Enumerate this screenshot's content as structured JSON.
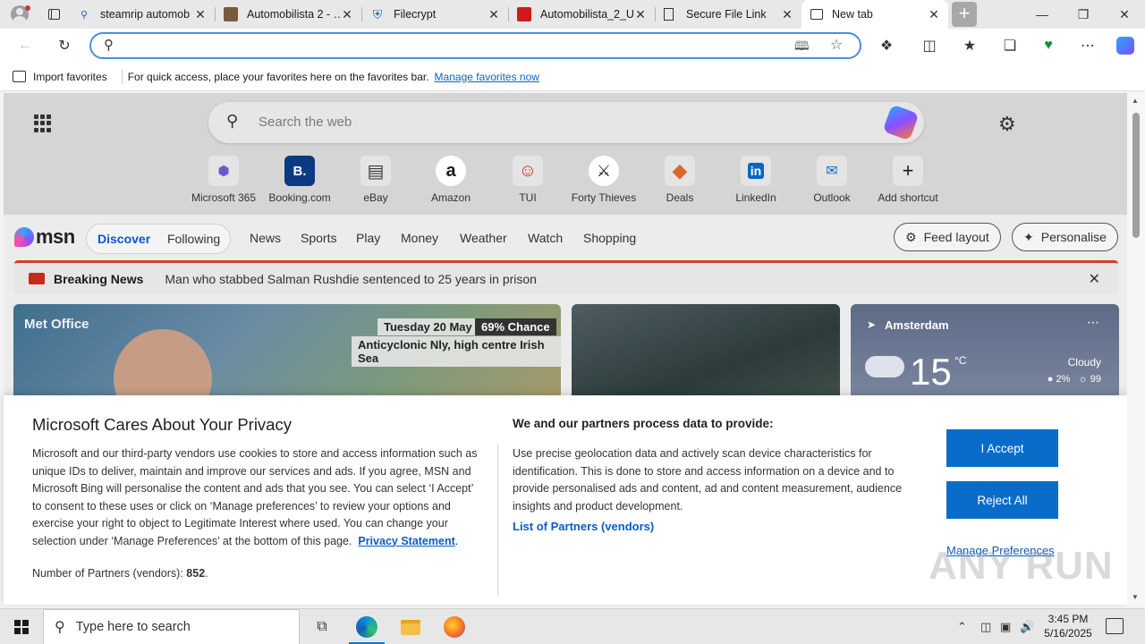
{
  "browser": {
    "tabs": [
      {
        "title": "steamrip automob",
        "icon": "search-icon"
      },
      {
        "title": "Automobilista 2 - …",
        "icon": "game-favicon"
      },
      {
        "title": "Filecrypt",
        "icon": "shield-icon"
      },
      {
        "title": "Automobilista_2_U",
        "icon": "red-favicon"
      },
      {
        "title": "Secure File Link",
        "icon": "document-icon"
      },
      {
        "title": "New tab",
        "icon": "newtab-icon"
      }
    ],
    "address": {
      "value": "",
      "placeholder": ""
    },
    "favorites_bar": {
      "import_label": "Import favorites",
      "message": "For quick access, place your favorites here on the favorites bar.",
      "manage_link": "Manage favorites now"
    }
  },
  "newtab": {
    "search_placeholder": "Search the web",
    "shortcuts": [
      {
        "label": "Microsoft 365",
        "glyph": "⬢",
        "color": "#6a5acd"
      },
      {
        "label": "Booking.com",
        "glyph": "B.",
        "color": "#0b3a82"
      },
      {
        "label": "eBay",
        "glyph": "▤",
        "color": "#3a3a3a"
      },
      {
        "label": "Amazon",
        "glyph": "a",
        "color": "#111111"
      },
      {
        "label": "TUI",
        "glyph": "☺",
        "color": "#e3262b"
      },
      {
        "label": "Forty Thieves",
        "glyph": "⚔",
        "color": "#222222"
      },
      {
        "label": "Deals",
        "glyph": "◆",
        "color": "#d9682b"
      },
      {
        "label": "LinkedIn",
        "glyph": "in",
        "color": "#0a66c2"
      },
      {
        "label": "Outlook",
        "glyph": "✉",
        "color": "#0f6cbd"
      },
      {
        "label": "Add shortcut",
        "glyph": "+",
        "color": "#333333"
      }
    ],
    "msn": {
      "logo": "msn",
      "discover": "Discover",
      "following": "Following",
      "nav": [
        "News",
        "Sports",
        "Play",
        "Money",
        "Weather",
        "Watch",
        "Shopping"
      ],
      "feed_layout": "Feed layout",
      "personalise": "Personalise"
    },
    "breaking": {
      "label": "Breaking News",
      "headline": "Man who stabbed Salman Rushdie sentenced to 25 years in prison"
    },
    "weather_card": {
      "brand": "Met Office",
      "date": "Tuesday 20 May",
      "chance": "69% Chance",
      "forecast": "Anticyclonic Nly, high centre Irish Sea"
    },
    "weather_widget": {
      "location": "Amsterdam",
      "temp": "15",
      "unit": "°C",
      "condition": "Cloudy",
      "precip": "2%",
      "humidity": "99"
    }
  },
  "privacy": {
    "title": "Microsoft Cares About Your Privacy",
    "body": "Microsoft and our third-party vendors use cookies to store and access information such as unique IDs to deliver, maintain and improve our services and ads. If you agree, MSN and Microsoft Bing will personalise the content and ads that you see. You can select ‘I Accept’ to consent to these uses or click on ‘Manage preferences’ to review your options and exercise your right to object to Legitimate Interest where used.  You can change your selection under ‘Manage Preferences’ at the bottom of this page.",
    "privacy_link": "Privacy Statement",
    "partners_label": "Number of Partners (vendors):",
    "partners_count": "852",
    "partners_suffix": ".",
    "data_heading": "We and our partners process data to provide:",
    "data_body": "Use precise geolocation data and actively scan device characteristics for identification. This is done to store and access information on a device and to provide personalised ads and content, ad and content measurement, audience insights and product development.",
    "list_link": "List of Partners (vendors)",
    "accept": "I Accept",
    "reject": "Reject All",
    "manage": "Manage Preferences"
  },
  "watermark": "ANY RUN",
  "taskbar": {
    "search_placeholder": "Type here to search",
    "time": "3:45 PM",
    "date": "5/16/2025"
  }
}
